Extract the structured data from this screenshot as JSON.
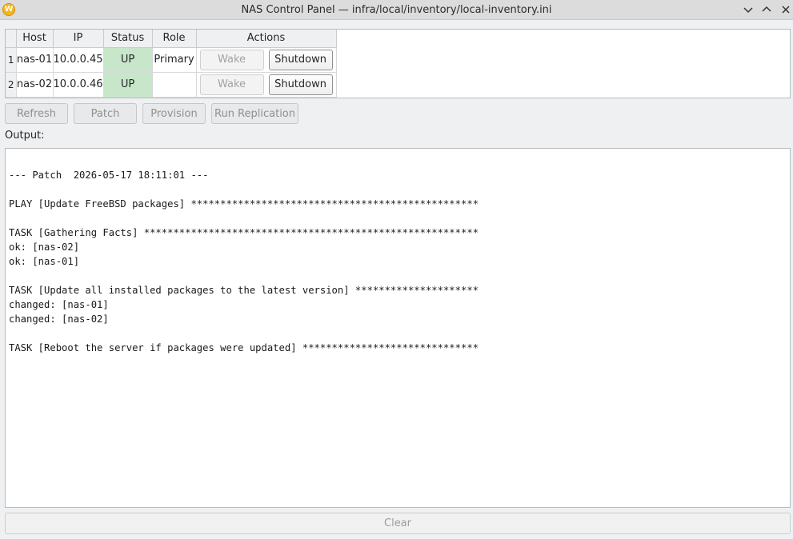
{
  "window": {
    "title": "NAS Control Panel — infra/local/inventory/local-inventory.ini",
    "app_icon_letter": "W",
    "controls": [
      "chevron-down",
      "chevron-up",
      "close"
    ]
  },
  "hosts_table": {
    "columns": [
      "Host",
      "IP",
      "Status",
      "Role",
      "Actions"
    ],
    "rows": [
      {
        "index": "1",
        "host": "nas-01",
        "ip": "10.0.0.45",
        "status": "UP",
        "role": "Primary",
        "wake": "Wake",
        "shutdown": "Shutdown"
      },
      {
        "index": "2",
        "host": "nas-02",
        "ip": "10.0.0.46",
        "status": "UP",
        "role": "",
        "wake": "Wake",
        "shutdown": "Shutdown"
      }
    ],
    "status_up_color": "#c8e6c9"
  },
  "toolbar": {
    "refresh": "Refresh",
    "patch": "Patch",
    "provision": "Provision",
    "replication": "Run Replication"
  },
  "output": {
    "label": "Output:",
    "text": "--- Patch  2026-05-17 18:11:01 ---\n\nPLAY [Update FreeBSD packages] *************************************************\n\nTASK [Gathering Facts] *********************************************************\nok: [nas-02]\nok: [nas-01]\n\nTASK [Update all installed packages to the latest version] *********************\nchanged: [nas-01]\nchanged: [nas-02]\n\nTASK [Reboot the server if packages were updated] ******************************"
  },
  "clear_button": "Clear"
}
